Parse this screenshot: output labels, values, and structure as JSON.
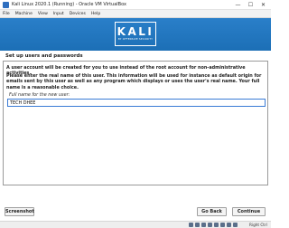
{
  "window": {
    "title": "Kali Linux 2020.1 (Running) - Oracle VM VirtualBox",
    "controls": {
      "minimize": "—",
      "maximize": "☐",
      "close": "✕"
    }
  },
  "menu": [
    "File",
    "Machine",
    "View",
    "Input",
    "Devices",
    "Help"
  ],
  "logo": {
    "word": "KALI",
    "tagline": "BY OFFENSIVE SECURITY"
  },
  "installer": {
    "step_title": "Set up users and passwords",
    "paragraph1": "A user account will be created for you to use instead of the root account for non-administrative activities.",
    "paragraph2": "Please enter the real name of this user. This information will be used for instance as default origin for emails sent by this user as well as any program which displays or uses the user's real name. Your full name is a reasonable choice.",
    "field_label": "Full name for the new user:",
    "field_value": "TECH DHEE"
  },
  "buttons": {
    "screenshot": "Screenshot",
    "go_back": "Go Back",
    "continue": "Continue"
  },
  "statusbar": {
    "host_key": "Right Ctrl"
  },
  "colors": {
    "header": "#1c6fb6",
    "accent": "#3a7bd5"
  }
}
